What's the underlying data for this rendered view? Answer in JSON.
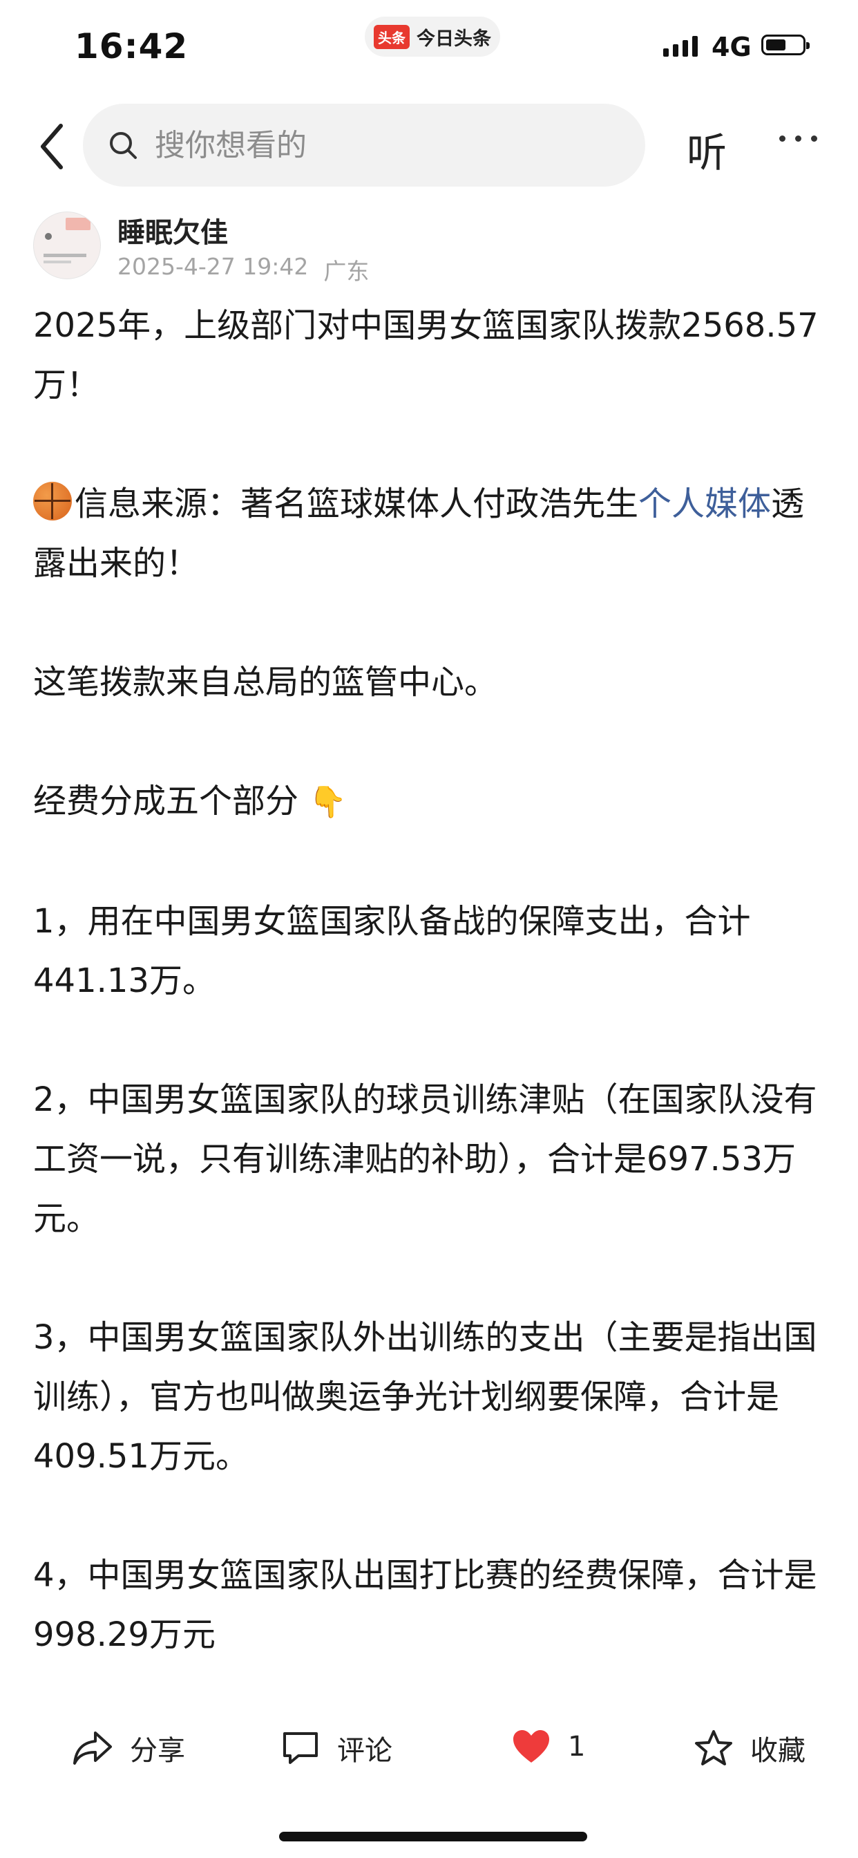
{
  "status_bar": {
    "time": "16:42",
    "app_badge": "头条",
    "app_name": "今日头条",
    "network": "4G"
  },
  "nav": {
    "search_placeholder": "搜你想看的",
    "listen_label": "听"
  },
  "author": {
    "name": "睡眠欠佳",
    "date": "2025-4-27 19:42",
    "location": "广东"
  },
  "article": {
    "p1": "2025年，上级部门对中国男女篮国家队拨款2568.57万！",
    "p2_prefix": "信息来源：著名篮球媒体人付政浩先生",
    "p2_link": "个人媒体",
    "p2_suffix": "透露出来的！",
    "p3": "这笔拨款来自总局的篮管中心。",
    "p4": "经费分成五个部分",
    "p5": "1，用在中国男女篮国家队备战的保障支出，合计441.13万。",
    "p6": "2，中国男女篮国家队的球员训练津贴（在国家队没有工资一说，只有训练津贴的补助），合计是697.53万元。",
    "p7": "3，中国男女篮国家队外出训练的支出（主要是指出国训练），官方也叫做奥运争光计划纲要保障，合计是409.51万元。",
    "p8": "4，中国男女篮国家队出国打比赛的经费保障，合计是998.29万元"
  },
  "actions": {
    "share": "分享",
    "comment": "评论",
    "like_count": "1",
    "favorite": "收藏"
  },
  "colors": {
    "link": "#3e5f9a",
    "like": "#ee3b3b",
    "badge": "#e8392f"
  }
}
